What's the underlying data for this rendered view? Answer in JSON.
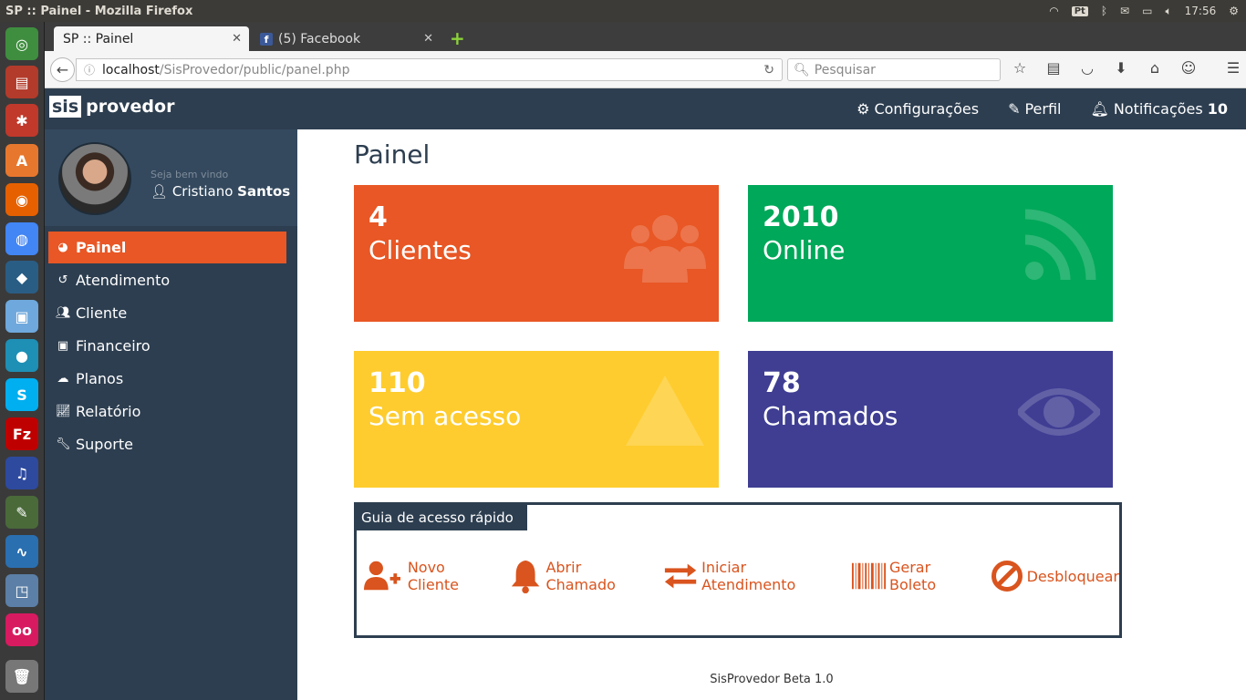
{
  "os": {
    "window_title": "SP :: Painel - Mozilla Firefox",
    "keyboard_layout": "Pt",
    "clock": "17:56"
  },
  "browser": {
    "tabs": [
      {
        "label": "SP :: Painel",
        "active": true
      },
      {
        "label": "(5) Facebook",
        "active": false
      }
    ],
    "url_host": "localhost",
    "url_path": "/SisProvedor/public/panel.php",
    "search_placeholder": "Pesquisar"
  },
  "header": {
    "logo_box": "sis",
    "logo_text": "provedor",
    "nav": [
      {
        "label": "Configurações",
        "icon": "gears-icon"
      },
      {
        "label": "Perfil",
        "icon": "pencil-icon"
      },
      {
        "label": "Notificações",
        "icon": "bell-icon",
        "count": "10"
      }
    ]
  },
  "sidebar": {
    "welcome": "Seja bem vindo",
    "user_first": "Cristiano",
    "user_last": "Santos",
    "items": [
      {
        "label": "Painel",
        "icon": "dashboard-icon",
        "active": true
      },
      {
        "label": "Atendimento",
        "icon": "history-icon"
      },
      {
        "label": "Cliente",
        "icon": "users-icon"
      },
      {
        "label": "Financeiro",
        "icon": "money-icon"
      },
      {
        "label": "Planos",
        "icon": "cloud-icon"
      },
      {
        "label": "Relatório",
        "icon": "line-chart-icon"
      },
      {
        "label": "Suporte",
        "icon": "wrench-icon"
      }
    ]
  },
  "main": {
    "title": "Painel",
    "cards": [
      {
        "value": "4",
        "label": "Clientes",
        "color": "#e85725",
        "icon": "users-icon"
      },
      {
        "value": "2010",
        "label": "Online",
        "color": "#00a859",
        "icon": "rss-icon"
      },
      {
        "value": "110",
        "label": "Sem acesso",
        "color": "#fecc2e",
        "icon": "warning-icon"
      },
      {
        "value": "78",
        "label": "Chamados",
        "color": "#3f3e93",
        "icon": "eye-icon"
      }
    ],
    "quick_access": {
      "title": "Guia de acesso rápido",
      "items": [
        {
          "label": "Novo Cliente",
          "icon": "user-plus-icon"
        },
        {
          "label": "Abrir Chamado",
          "icon": "bell-icon"
        },
        {
          "label": "Iniciar Atendimento",
          "icon": "exchange-icon"
        },
        {
          "label": "Gerar Boleto",
          "icon": "barcode-icon"
        },
        {
          "label": "Desbloquear",
          "icon": "ban-icon"
        }
      ]
    },
    "footer": "SisProvedor Beta 1.0"
  }
}
